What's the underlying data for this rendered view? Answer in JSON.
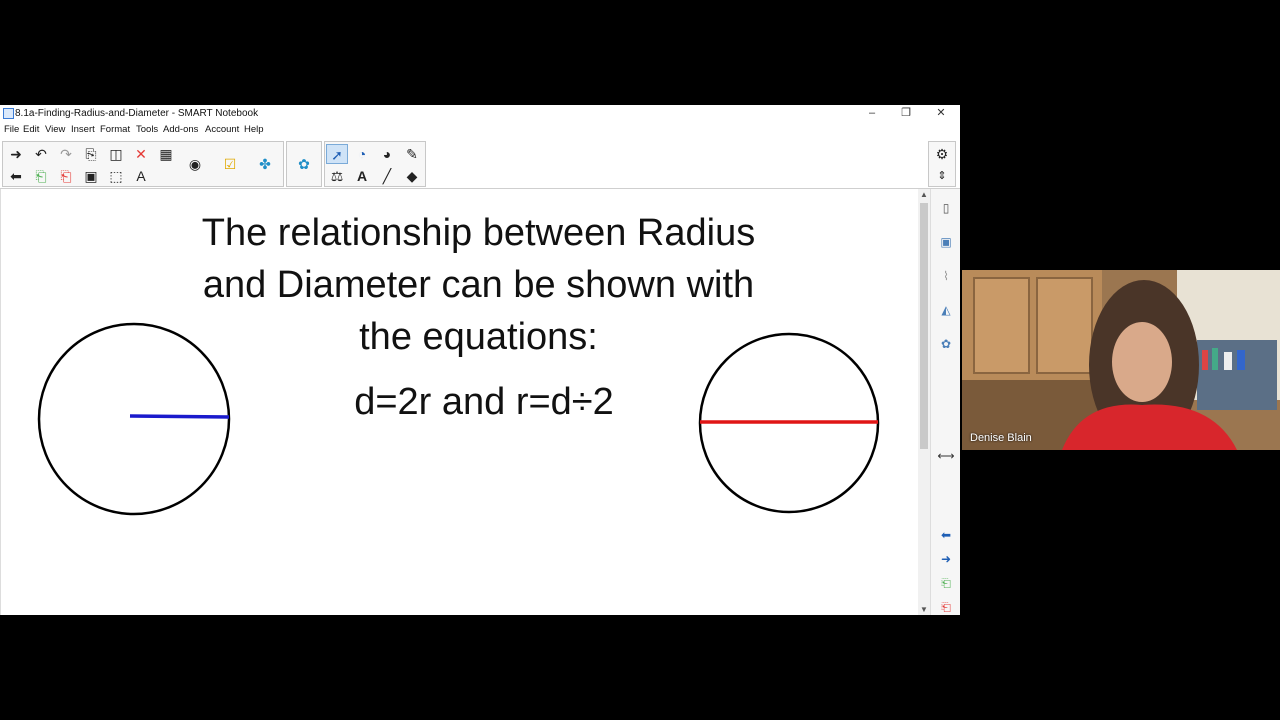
{
  "window": {
    "title": "8.1a-Finding-Radius-and-Diameter - SMART Notebook",
    "controls": {
      "minimize": "–",
      "restore": "❐",
      "close": "✕"
    }
  },
  "menu": {
    "items": [
      "File",
      "Edit",
      "View",
      "Insert",
      "Format",
      "Tools",
      "Add-ons",
      "Account",
      "Help"
    ]
  },
  "toolbar": {
    "icons": [
      "next-page-icon",
      "undo-icon",
      "redo-icon",
      "open-icon",
      "screen-capture-icon",
      "delete-icon",
      "table-icon",
      "document-camera-icon",
      "response-icon",
      "addons-icon",
      "lesson-activity-icon",
      "select-icon",
      "shapes-icon",
      "fill-icon",
      "magic-pen-icon",
      "previous-page-icon",
      "import-icon",
      "export-icon",
      "save-icon",
      "full-screen-icon",
      "text-icon",
      "measurement-icon",
      "line-icon",
      "eraser-icon",
      "settings-icon",
      "toolbar-move-icon"
    ]
  },
  "slide": {
    "title": "The relationship between Radius\nand Diameter can be shown with\nthe equations:",
    "equation": "d=2r and r=d÷2",
    "radius_color": "#1a1acc",
    "diameter_color": "#e01515"
  },
  "side_tabs": [
    "page-sorter-icon",
    "gallery-icon",
    "attachments-icon",
    "properties-icon",
    "addons-tab-icon"
  ],
  "video": {
    "participant_name": "Denise Blain"
  }
}
